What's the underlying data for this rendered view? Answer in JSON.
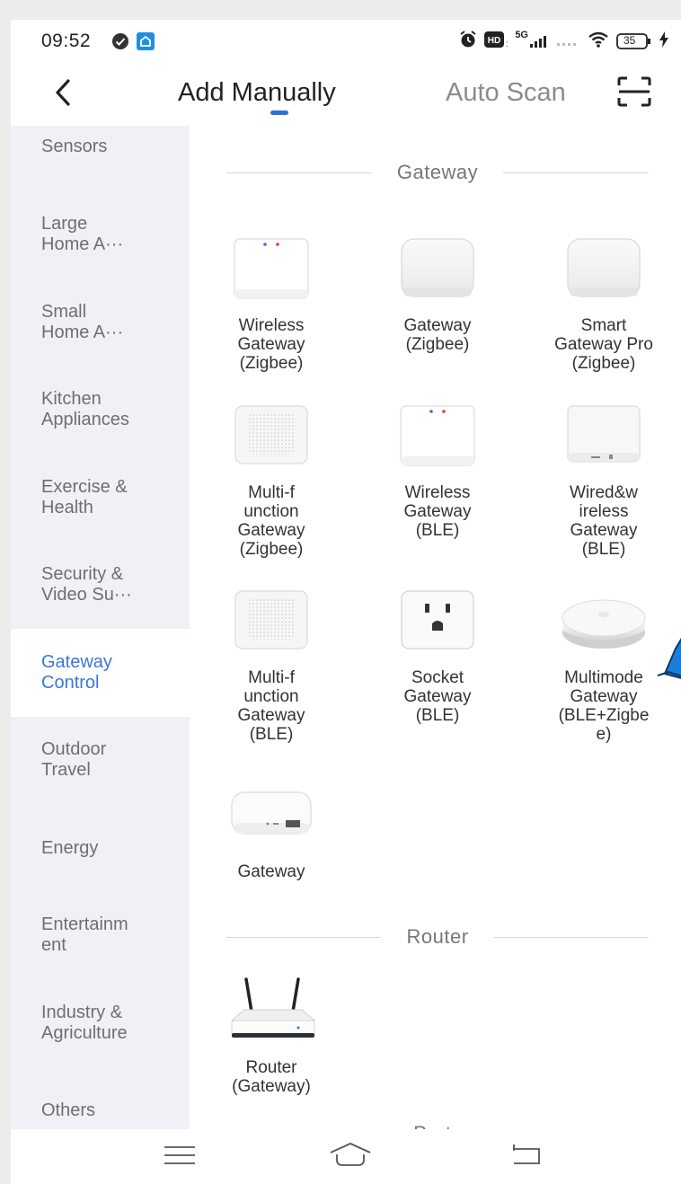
{
  "status_bar": {
    "time": "09:52",
    "network": "5G",
    "battery": "35"
  },
  "header": {
    "tabs": [
      {
        "label": "Add Manually",
        "active": true
      },
      {
        "label": "Auto Scan",
        "active": false
      }
    ]
  },
  "sidebar": {
    "items": [
      {
        "label": "Sensors",
        "active": false
      },
      {
        "label": "Large\nHome A···",
        "active": false
      },
      {
        "label": "Small\nHome A···",
        "active": false
      },
      {
        "label": "Kitchen\nAppliances",
        "active": false
      },
      {
        "label": "Exercise &\nHealth",
        "active": false
      },
      {
        "label": "Security &\nVideo Su···",
        "active": false
      },
      {
        "label": "Gateway\nControl",
        "active": true
      },
      {
        "label": "Outdoor\nTravel",
        "active": false
      },
      {
        "label": "Energy",
        "active": false
      },
      {
        "label": "Entertainm\nent",
        "active": false
      },
      {
        "label": "Industry &\nAgriculture",
        "active": false
      },
      {
        "label": "Others",
        "active": false
      }
    ]
  },
  "sections": [
    {
      "title": "Gateway",
      "devices": [
        {
          "label": "Wireless\nGateway\n(Zigbee)",
          "icon": "wireless-gateway-leds"
        },
        {
          "label": "Gateway\n(Zigbee)",
          "icon": "gateway-square"
        },
        {
          "label": "Smart\nGateway Pro\n(Zigbee)",
          "icon": "gateway-square"
        },
        {
          "label": "Multi-f\nunction\nGateway\n(Zigbee)",
          "icon": "speaker-grille-gateway"
        },
        {
          "label": "Wireless\nGateway\n(BLE)",
          "icon": "wireless-gateway-leds"
        },
        {
          "label": "Wired&w\nireless\nGateway\n(BLE)",
          "icon": "wired-gateway"
        },
        {
          "label": "Multi-f\nunction\nGateway\n(BLE)",
          "icon": "speaker-grille-gateway"
        },
        {
          "label": "Socket\nGateway\n(BLE)",
          "icon": "socket-gateway"
        },
        {
          "label": "Multimode\nGateway\n(BLE+Zigbe\ne)",
          "icon": "round-hub"
        },
        {
          "label": "Gateway",
          "icon": "flat-gateway"
        }
      ]
    },
    {
      "title": "Router",
      "devices": [
        {
          "label": "Router\n(Gateway)",
          "icon": "router"
        }
      ]
    },
    {
      "title": "Parts",
      "devices": []
    }
  ],
  "colors": {
    "accent": "#3b78d8",
    "sidebar_bg": "#eff1f6",
    "active_bg": "#ffffff"
  }
}
